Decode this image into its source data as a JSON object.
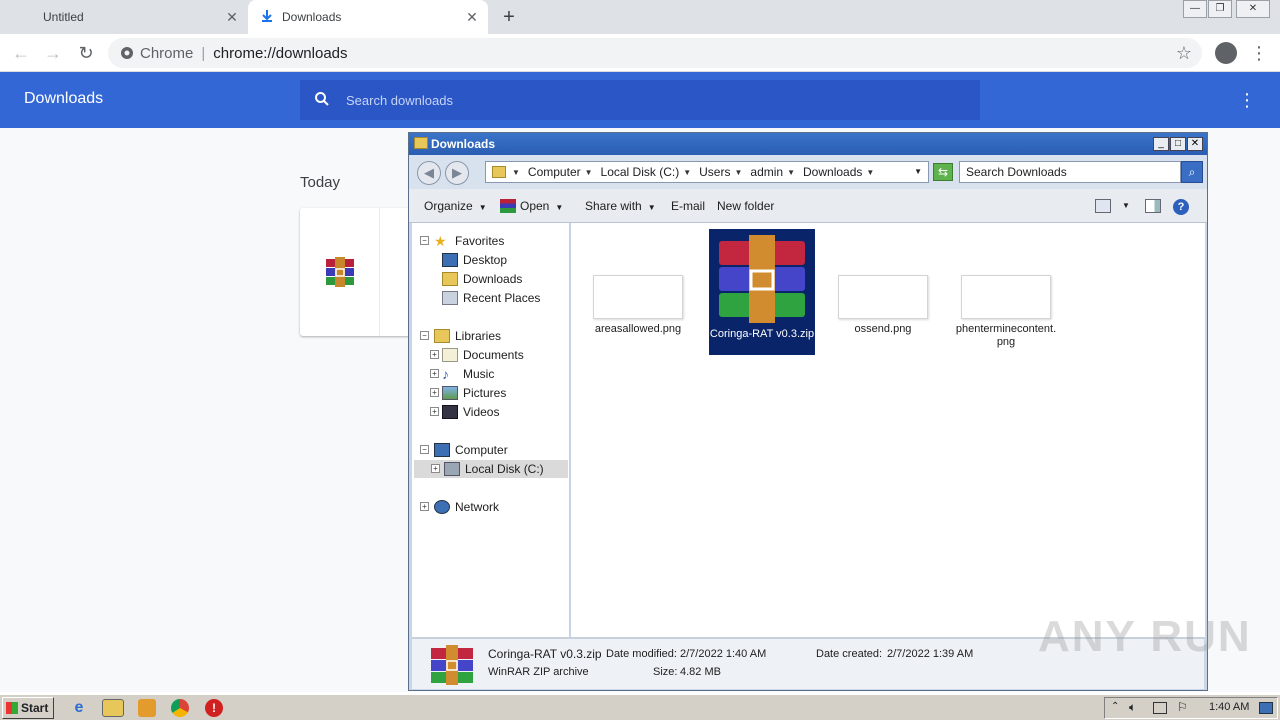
{
  "browser": {
    "tabs": [
      {
        "label": "Untitled"
      },
      {
        "label": "Downloads"
      }
    ],
    "omnibox": {
      "site_label": "Chrome",
      "url": "chrome://downloads"
    }
  },
  "downloads_page": {
    "title": "Downloads",
    "search_placeholder": "Search downloads",
    "date_group": "Today"
  },
  "explorer": {
    "title": "Downloads",
    "breadcrumbs": [
      "Computer",
      "Local Disk (C:)",
      "Users",
      "admin",
      "Downloads"
    ],
    "search_placeholder": "Search Downloads",
    "commands": {
      "organize": "Organize",
      "open": "Open",
      "share_with": "Share with",
      "email": "E-mail",
      "new_folder": "New folder"
    },
    "nav": {
      "favorites": "Favorites",
      "desktop": "Desktop",
      "downloads": "Downloads",
      "recent_places": "Recent Places",
      "libraries": "Libraries",
      "documents": "Documents",
      "music": "Music",
      "pictures": "Pictures",
      "videos": "Videos",
      "computer": "Computer",
      "local_disk": "Local Disk (C:)",
      "network": "Network"
    },
    "files": [
      {
        "name": "areasallowed.png"
      },
      {
        "name": "Coringa-RAT v0.3.zip"
      },
      {
        "name": "ossend.png"
      },
      {
        "name": "phenterminecontent.png"
      }
    ],
    "status": {
      "filename": "Coringa-RAT v0.3.zip",
      "modified_label": "Date modified:",
      "modified_value": "2/7/2022 1:40 AM",
      "created_label": "Date created:",
      "created_value": "2/7/2022 1:39 AM",
      "type": "WinRAR ZIP archive",
      "size_label": "Size:",
      "size_value": "4.82 MB"
    }
  },
  "taskbar": {
    "start_label": "Start",
    "clock": "1:40 AM"
  },
  "watermark": "ANY RUN",
  "colors": {
    "chrome_header_blue": "#3367d6",
    "selection_navy": "#0a246a"
  }
}
